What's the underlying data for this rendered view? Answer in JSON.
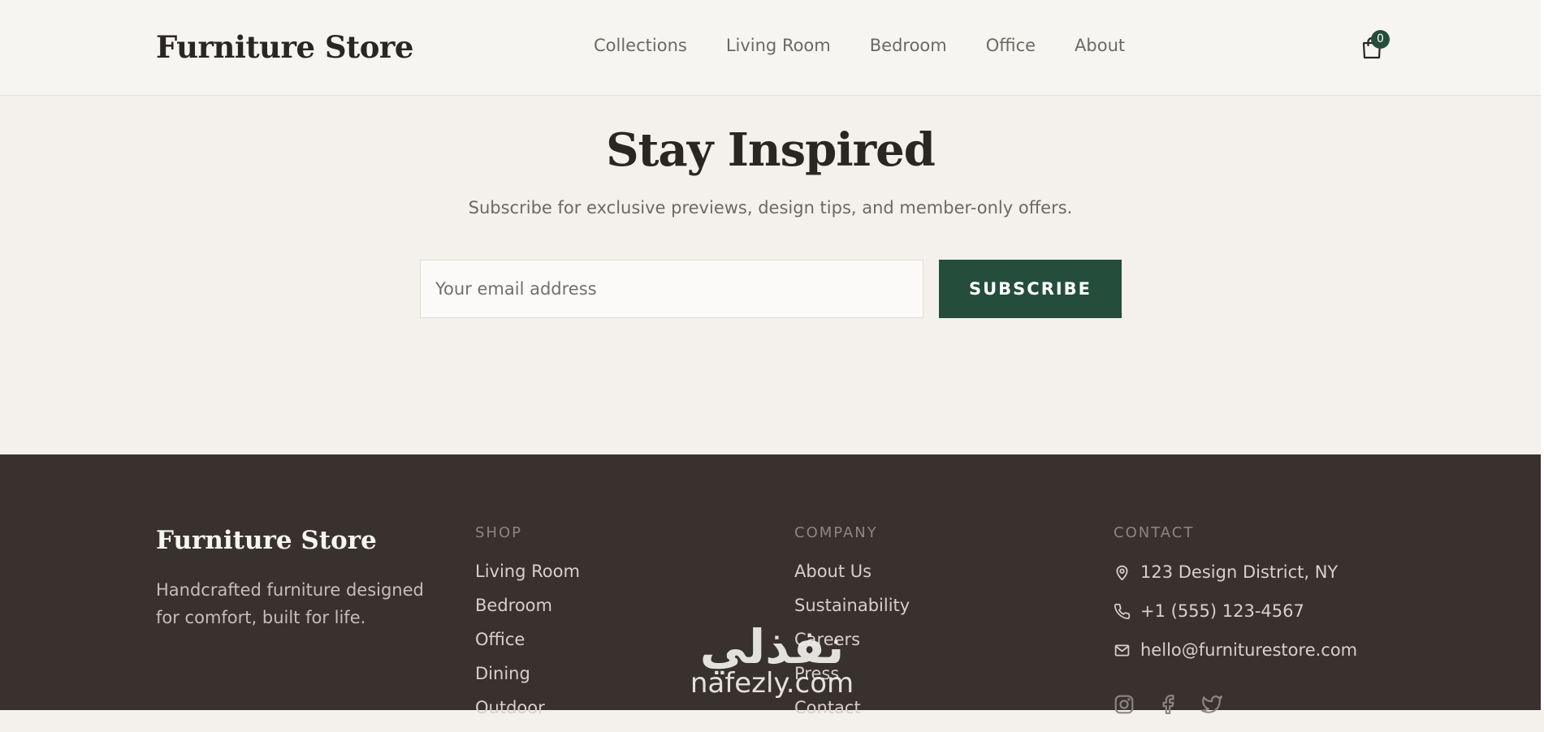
{
  "header": {
    "logo": "Furniture Store",
    "nav": [
      "Collections",
      "Living Room",
      "Bedroom",
      "Office",
      "About"
    ],
    "cart_count": "0"
  },
  "newsletter": {
    "title": "Stay Inspired",
    "subtitle": "Subscribe for exclusive previews, design tips, and member-only offers.",
    "email_placeholder": "Your email address",
    "button": "SUBSCRIBE"
  },
  "footer": {
    "logo": "Furniture Store",
    "tagline": "Handcrafted furniture designed for comfort, built for life.",
    "shop": {
      "heading": "SHOP",
      "items": [
        "Living Room",
        "Bedroom",
        "Office",
        "Dining",
        "Outdoor"
      ]
    },
    "company": {
      "heading": "COMPANY",
      "items": [
        "About Us",
        "Sustainability",
        "Careers",
        "Press",
        "Contact"
      ]
    },
    "contact": {
      "heading": "CONTACT",
      "address": "123 Design District, NY",
      "phone": "+1 (555) 123-4567",
      "email": "hello@furniturestore.com"
    },
    "social": [
      "instagram-icon",
      "facebook-icon",
      "twitter-icon"
    ]
  },
  "watermark": {
    "arabic": "نفذلي",
    "latin": "nafezly.com"
  },
  "colors": {
    "accent": "#244d3c",
    "footer_bg": "#38312d",
    "page_bg": "#f4f1ec"
  }
}
